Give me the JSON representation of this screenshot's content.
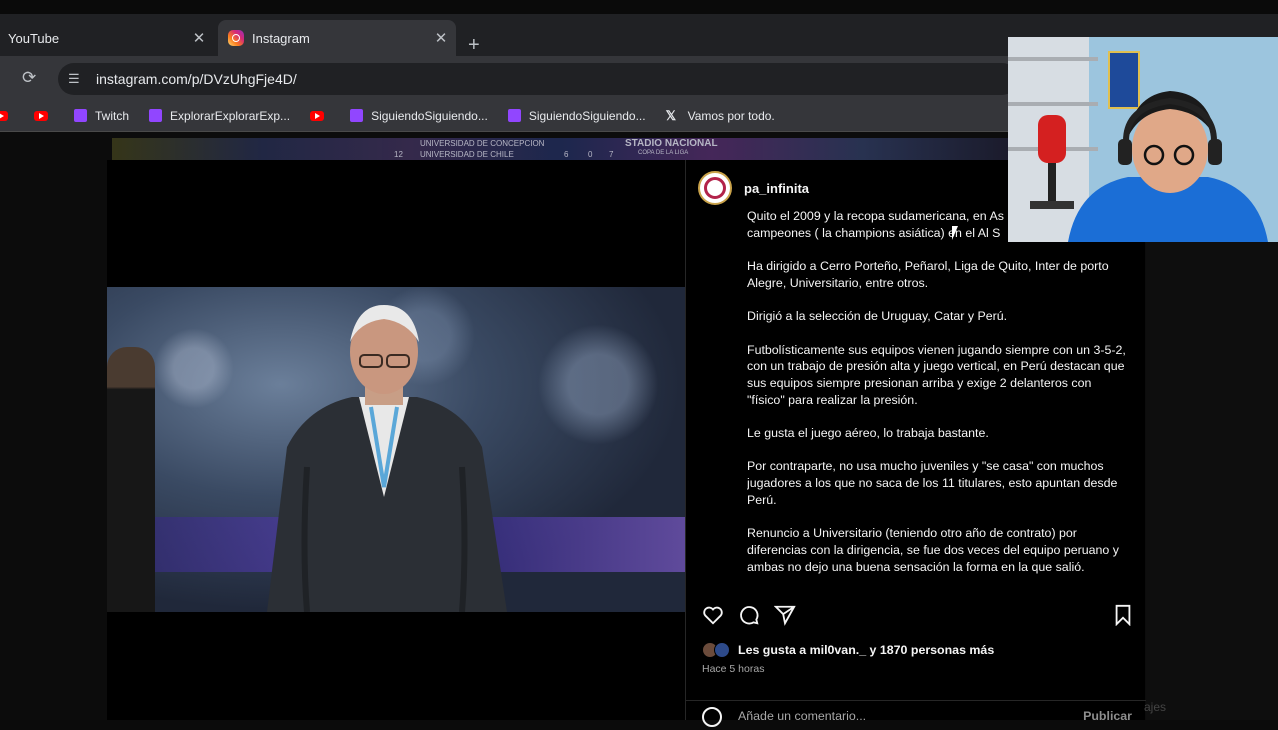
{
  "browser": {
    "tabs": [
      {
        "title": "YouTube",
        "active": false
      },
      {
        "title": "Instagram",
        "active": true
      }
    ],
    "close_glyph": "✕",
    "new_tab_glyph": "+",
    "url": "instagram.com/p/DVzUhgFje4D/",
    "bookmarks": [
      {
        "label": "",
        "icon": "youtube-icon"
      },
      {
        "label": "",
        "icon": "youtube-icon"
      },
      {
        "label": "Twitch",
        "icon": "twitch-icon"
      },
      {
        "label": "ExplorarExplorarExp...",
        "icon": "twitch-icon"
      },
      {
        "label": "",
        "icon": "youtube-icon"
      },
      {
        "label": "SiguiendoSiguiendo...",
        "icon": "twitch-icon"
      },
      {
        "label": "SiguiendoSiguiendo...",
        "icon": "twitch-icon"
      },
      {
        "label": "Vamos por todo.",
        "icon": "x-icon"
      }
    ]
  },
  "background_strip": {
    "row1": "UNIVERSIDAD DE CONCEPCION",
    "row2_rank": "12",
    "row2": "UNIVERSIDAD DE CHILE",
    "row2_a": "6",
    "row2_b": "0",
    "row2_c": "7",
    "stadium": "STADIO NACIONAL",
    "stadium_sub": "COPA DE LA LIGA"
  },
  "post": {
    "username": "pa_infinita",
    "caption": [
      "Quito el 2009 y la recopa sudamericana, en As",
      "campeones ( la champions asiática) en el Al S",
      "",
      "Ha dirigido a Cerro Porteño, Peñarol, Liga de Quito, Inter de porto Alegre, Universitario, entre otros.",
      "Dirigió a la selección de Uruguay, Catar y Perú.",
      "Futbolísticamente sus equipos vienen jugando siempre con un 3-5-2, con un trabajo de presión alta y juego vertical, en Perú destacan que sus equipos siempre presionan arriba y exige 2 delanteros con \"físico\" para realizar la presión.",
      "Le gusta el juego aéreo, lo trabaja bastante.",
      "Por contraparte, no usa mucho juveniles y \"se casa\" con muchos jugadores a los que no saca de los 11 titulares, esto apuntan desde Perú.",
      "Renuncio a Universitario (teniendo otro año de contrato) por diferencias con la dirigencia, se fue dos veces del equipo peruano y ambas no dejo una buena sensación la forma en la que salió."
    ],
    "likes_text": "Les gusta a mil0van._ y 1870 personas más",
    "time": "Hace 5 horas",
    "comment_placeholder": "Añade un comentario...",
    "publish_label": "Publicar",
    "messages_label": "ajes"
  },
  "colors": {
    "tab_bar": "#202124",
    "toolbar": "#35363a",
    "panel_bg": "#000000",
    "secondary_text": "#a8a8a8"
  }
}
